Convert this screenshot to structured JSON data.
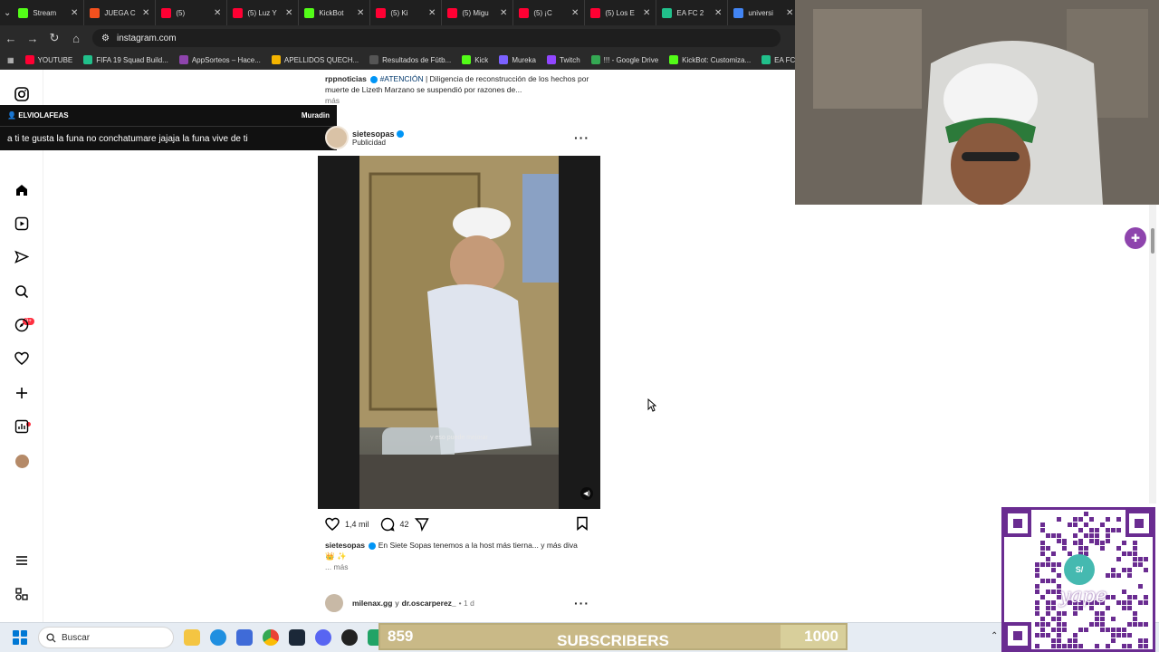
{
  "browser": {
    "tabs": [
      {
        "title": "Stream",
        "color": "#53fc18"
      },
      {
        "title": "JUEGA C",
        "color": "#f4511e"
      },
      {
        "title": "(5) ",
        "color": "#ff0033"
      },
      {
        "title": "(5) Luz Y",
        "color": "#ff0033"
      },
      {
        "title": "KickBot",
        "color": "#53fc18"
      },
      {
        "title": "(5) Ki",
        "color": "#ff0033"
      },
      {
        "title": "(5) Migu",
        "color": "#ff0033"
      },
      {
        "title": "(5) ¡C",
        "color": "#ff0033"
      },
      {
        "title": "(5) Los E",
        "color": "#ff0033"
      },
      {
        "title": "EA FC 2",
        "color": "#21c08b"
      },
      {
        "title": "universi",
        "color": "#4285f4"
      }
    ],
    "url": "instagram.com",
    "bookmarks": [
      {
        "label": "YOUTUBE",
        "color": "#ff0033"
      },
      {
        "label": "FIFA 19 Squad Build...",
        "color": "#21c08b"
      },
      {
        "label": "AppSorteos – Hace...",
        "color": "#8e44ad"
      },
      {
        "label": "APELLIDOS QUECH...",
        "color": "#f4b400"
      },
      {
        "label": "Resultados de Fútb...",
        "color": "#555555"
      },
      {
        "label": "Kick",
        "color": "#53fc18"
      },
      {
        "label": "Mureka",
        "color": "#7b61ff"
      },
      {
        "label": "Twitch",
        "color": "#9146ff"
      },
      {
        "label": "!!! - Google Drive",
        "color": "#34a853"
      },
      {
        "label": "KickBot: Customiza...",
        "color": "#53fc18"
      },
      {
        "label": "EA FC 2",
        "color": "#21c08b"
      }
    ]
  },
  "chat": {
    "username": "ELVIOLAFEAS",
    "channel": "Muradin",
    "message": "a ti te gusta la funa no conchatumare jajaja la funa vive de ti"
  },
  "sidebar": {
    "notifications_badge": "9+"
  },
  "prev_post": {
    "username": "rppnoticias",
    "hashtag": "#ATENCIÓN",
    "text": "| Diligencia de reconstrucción de los hechos por muerte de Lizeth Marzano se suspendió por razones de...",
    "more": "más"
  },
  "post": {
    "username": "sietesopas",
    "sponsored": "Publicidad",
    "video_subtitle": "y eso puede mejorar",
    "likes": "1,4 mil",
    "comments": "42",
    "caption_user": "sietesopas",
    "caption_text": "En Siete Sopas tenemos a la host más tierna... y más diva",
    "caption_emoji": "👑 ✨",
    "more": "... más"
  },
  "next_post": {
    "user1": "milenax.gg",
    "connector": "y",
    "user2": "dr.oscarperez_",
    "time": "• 1 d"
  },
  "taskbar": {
    "search_placeholder": "Buscar"
  },
  "subscribers": {
    "current": "859",
    "label": "SUBSCRIBERS",
    "goal": "1000",
    "progress": 0.859
  },
  "qr": {
    "brand": "yape",
    "badge": "S/"
  }
}
